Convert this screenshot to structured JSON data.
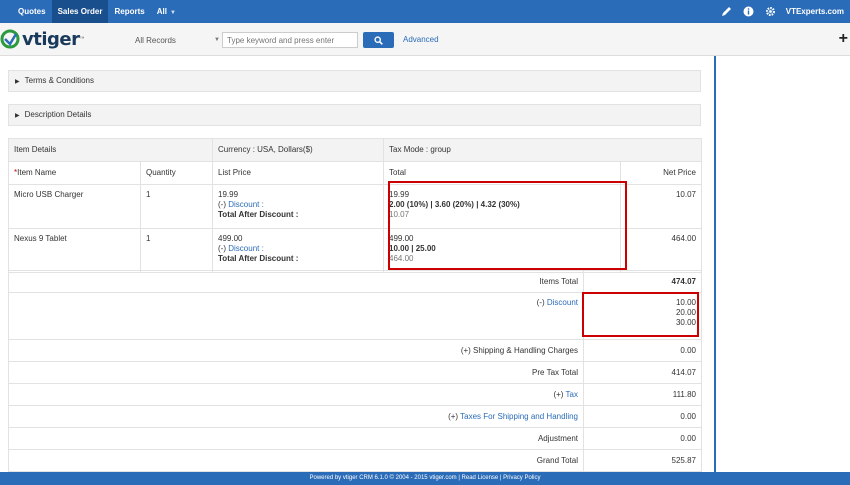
{
  "nav": {
    "items": [
      "Quotes",
      "Sales Order",
      "Reports"
    ],
    "all_label": "All",
    "company": "VTExperts.com"
  },
  "header": {
    "logo_text": "vtiger",
    "filter_value": "All Records",
    "search_placeholder": "Type keyword and press enter",
    "advanced_label": "Advanced",
    "add_symbol": "+"
  },
  "sections": {
    "terms": "Terms & Conditions",
    "description": "Description Details"
  },
  "items_table": {
    "item_details": "Item Details",
    "currency": "Currency : USA, Dollars($)",
    "tax_mode": "Tax Mode : group",
    "columns": {
      "name_star": "*",
      "name": "Item Name",
      "quantity": "Quantity",
      "list_price": "List Price",
      "total": "Total",
      "net_price": "Net Price"
    },
    "discount_prefix": "(-) ",
    "discount_label": "Discount :",
    "total_after_discount_label": "Total After Discount :",
    "rows": [
      {
        "name": "Micro USB Charger",
        "quantity": "1",
        "list_price": "19.99",
        "total": "19.99",
        "discount_breakdown": "2.00 (10%) | 3.60 (20%) | 4.32 (30%)",
        "total_after_discount": "10.07",
        "net_price": "10.07"
      },
      {
        "name": "Nexus 9 Tablet",
        "quantity": "1",
        "list_price": "499.00",
        "total": "499.00",
        "discount_breakdown": "10.00 | 25.00",
        "total_after_discount": "464.00",
        "net_price": "464.00"
      }
    ]
  },
  "totals": {
    "items_total_label": "Items Total",
    "items_total": "474.07",
    "discount_prefix": "(-) ",
    "discount_label": "Discount",
    "discount_values": [
      "10.00",
      "20.00",
      "30.00"
    ],
    "shipping_label": "(+) Shipping & Handling Charges",
    "shipping": "0.00",
    "pre_tax_label": "Pre Tax Total",
    "pre_tax": "414.07",
    "tax_prefix": "(+) ",
    "tax_label": "Tax",
    "tax": "111.80",
    "shipping_tax_prefix": "(+) ",
    "shipping_tax_label": "Taxes For Shipping and Handling",
    "shipping_tax": "0.00",
    "adjustment_label": "Adjustment",
    "adjustment": "0.00",
    "grand_total_label": "Grand Total",
    "grand_total": "525.87"
  },
  "footer": "Powered by vtiger CRM 6.1.0 © 2004 - 2015  vtiger.com | Read License | Privacy Policy",
  "colors": {
    "brand_blue": "#2b6cb8",
    "highlight_red": "#cc0000"
  }
}
